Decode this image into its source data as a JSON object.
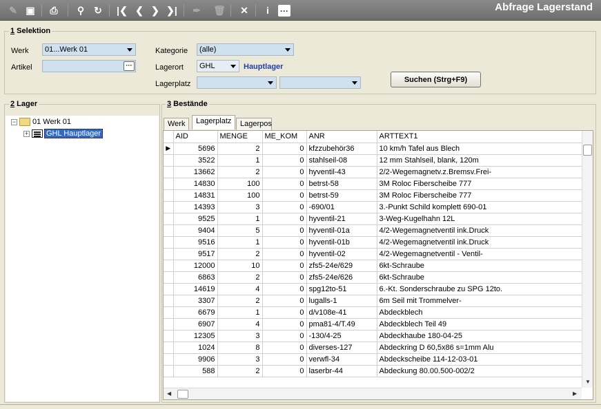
{
  "window": {
    "title": "Abfrage Lagerstand"
  },
  "toolbar": {
    "info_label": "i",
    "more_label": "···"
  },
  "selektion": {
    "title_num": "1",
    "title_text": " Selektion",
    "werk_label": "Werk",
    "werk_value": "01...Werk 01",
    "artikel_label": "Artikel",
    "artikel_value": "",
    "artikel_btn": "···",
    "kategorie_label": "Kategorie",
    "kategorie_value": "(alle)",
    "lagerort_label": "Lagerort",
    "lagerort_value": "GHL",
    "lagerort_name": "Hauptlager",
    "lagerplatz_label": "Lagerplatz",
    "lagerplatz_value": "",
    "lagerplatz_value2": "",
    "search_button": "Suchen (Strg+F9)"
  },
  "lager": {
    "title_num": "2",
    "title_text": " Lager",
    "root_node": "01 Werk 01",
    "child_node": "GHL Hauptlager",
    "root_expander": "−",
    "child_expander": "+"
  },
  "bestaende": {
    "title_num": "3",
    "title_text": " Bestände",
    "tabs": [
      "Werk",
      "Lagerplatz",
      "Lagerpos"
    ],
    "active_tab": 1,
    "columns": [
      "AID",
      "MENGE",
      "ME_KOM",
      "ANR",
      "ARTTEXT1"
    ],
    "rows": [
      [
        "5696",
        "2",
        "0",
        "kfzzubehör36",
        "10 km/h Tafel aus Blech"
      ],
      [
        "3522",
        "1",
        "0",
        "stahlseil-08",
        "12 mm Stahlseil, blank, 120m"
      ],
      [
        "13662",
        "2",
        "0",
        "hyventil-43",
        "2/2-Wegemagnetv.z.Bremsv.Frei-"
      ],
      [
        "14830",
        "100",
        "0",
        "betrst-58",
        "3M Roloc Fiberscheibe 777"
      ],
      [
        "14831",
        "100",
        "0",
        "betrst-59",
        "3M Roloc Fiberscheibe 777"
      ],
      [
        "14393",
        "3",
        "0",
        "-690/01",
        "3.-Punkt Schild komplett 690-01"
      ],
      [
        "9525",
        "1",
        "0",
        "hyventil-21",
        "3-Weg-Kugelhahn  12L"
      ],
      [
        "9404",
        "5",
        "0",
        "hyventil-01a",
        "4/2-Wegemagnetventil ink.Druck"
      ],
      [
        "9516",
        "1",
        "0",
        "hyventil-01b",
        "4/2-Wegemagnetventil ink.Druck"
      ],
      [
        "9517",
        "2",
        "0",
        "hyventil-02",
        "4/2-Wegemagnetventil - Ventil-"
      ],
      [
        "12000",
        "10",
        "0",
        "zfs5-24e/629",
        "6kt-Schraube"
      ],
      [
        "6863",
        "2",
        "0",
        "zfs5-24e/626",
        "6kt-Schraube"
      ],
      [
        "14619",
        "4",
        "0",
        "spg12to-51",
        "6.-Kt. Sonderschraube zu SPG 12to."
      ],
      [
        "3307",
        "2",
        "0",
        "lugalls-1",
        "6m Seil mit Trommelver-"
      ],
      [
        "6679",
        "1",
        "0",
        "d/v108e-41",
        "Abdeckblech"
      ],
      [
        "6907",
        "4",
        "0",
        "pma81-4/T.49",
        "Abdeckblech Teil 49"
      ],
      [
        "12305",
        "3",
        "0",
        "-130/4-25",
        "Abdeckhaube       180-04-25"
      ],
      [
        "1024",
        "8",
        "0",
        "diverses-127",
        "Abdeckring D 60,5x86 s=1mm Alu"
      ],
      [
        "9906",
        "3",
        "0",
        "verwfl-34",
        "Abdeckscheibe     114-12-03-01"
      ],
      [
        "588",
        "2",
        "0",
        "laserbr-44",
        "Abdeckung      80.00.500-002/2"
      ]
    ]
  }
}
